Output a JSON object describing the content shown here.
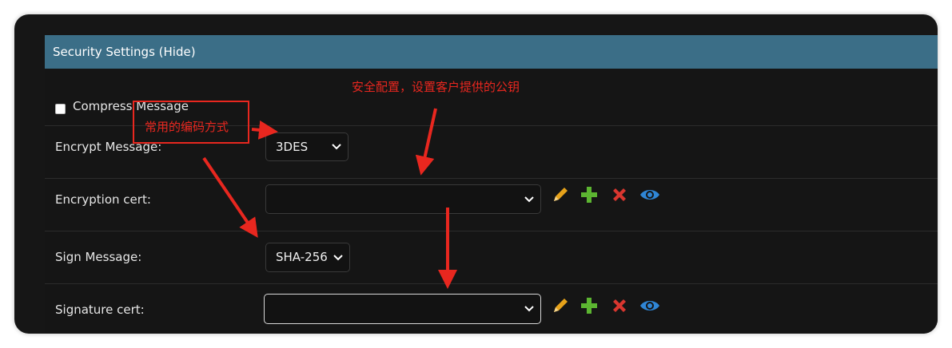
{
  "security": {
    "header": "Security Settings (Hide)",
    "compress_label": "Compress Message",
    "compress_checked": false,
    "encrypt_label": "Encrypt Message:",
    "encrypt_value": "3DES",
    "encryption_cert_label": "Encryption cert:",
    "encryption_cert_value": "",
    "sign_label": "Sign Message:",
    "sign_value": "SHA-256",
    "signature_cert_label": "Signature cert:",
    "signature_cert_value": ""
  },
  "annotations": {
    "encoding_note": "常用的编码方式",
    "security_note": "安全配置，设置客户提供的公钥"
  },
  "colors": {
    "header_bg": "#3b6e87",
    "annotation_red": "#e8271f",
    "edit_icon": "#e6a21a",
    "add_icon": "#5cb531",
    "delete_icon": "#d9362f",
    "view_icon": "#2f86d6"
  },
  "icons": [
    "pencil-icon",
    "plus-icon",
    "x-icon",
    "eye-icon"
  ]
}
